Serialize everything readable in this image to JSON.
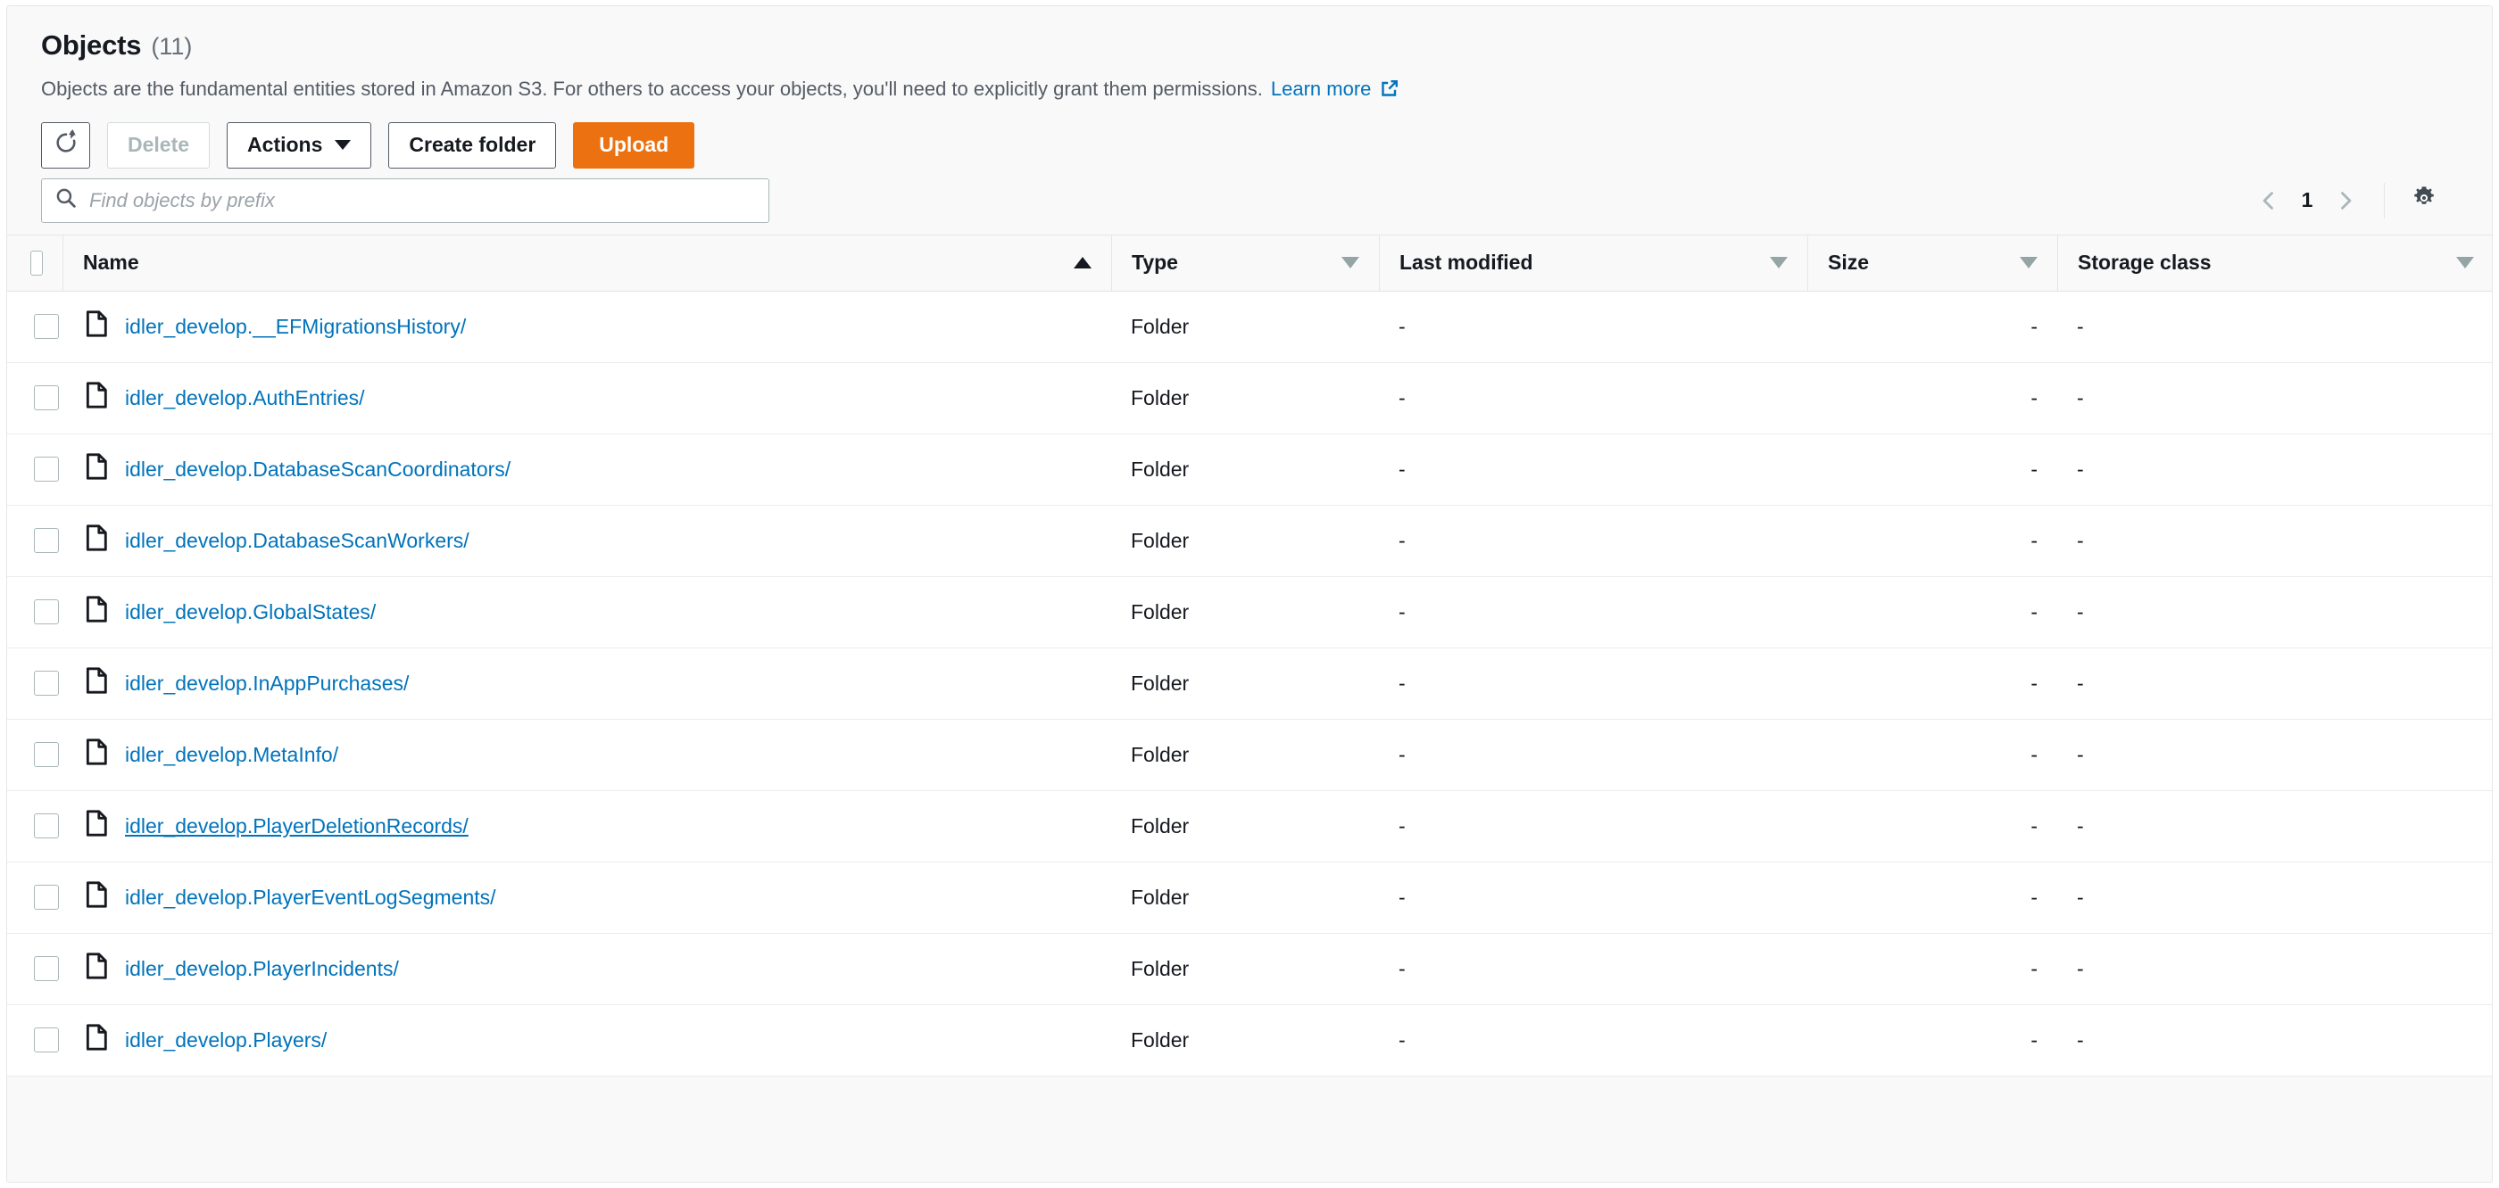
{
  "panel": {
    "title": "Objects",
    "count": "(11)",
    "description": "Objects are the fundamental entities stored in Amazon S3. For others to access your objects, you'll need to explicitly grant them permissions.",
    "learn_more_label": "Learn more",
    "learn_more_icon": "external-link-icon"
  },
  "toolbar": {
    "refresh_icon": "refresh-icon",
    "refresh_label": "",
    "delete_label": "Delete",
    "delete_disabled": true,
    "actions_label": "Actions",
    "actions_caret_icon": "chevron-down-icon",
    "create_folder_label": "Create folder",
    "upload_label": "Upload",
    "upload_color": "#ec7211"
  },
  "search": {
    "icon": "search-icon",
    "placeholder": "Find objects by prefix",
    "value": ""
  },
  "pagination": {
    "prev_icon": "chevron-left-icon",
    "page": "1",
    "next_icon": "chevron-right-icon",
    "settings_icon": "gear-icon"
  },
  "table": {
    "select_all_checkbox": "select-all-checkbox",
    "columns": [
      {
        "label": "Name",
        "sort": "asc",
        "sort_icon": "triangle-up-icon"
      },
      {
        "label": "Type",
        "sort": "none",
        "sort_icon": "triangle-down-outline-icon"
      },
      {
        "label": "Last modified",
        "sort": "none",
        "sort_icon": "triangle-down-outline-icon"
      },
      {
        "label": "Size",
        "sort": "none",
        "sort_icon": "triangle-down-outline-icon"
      },
      {
        "label": "Storage class",
        "sort": "none",
        "sort_icon": "triangle-down-outline-icon"
      }
    ],
    "rows": [
      {
        "name": "idler_develop.__EFMigrationsHistory/",
        "type": "Folder",
        "last_modified": "-",
        "size": "-",
        "storage_class": "-",
        "hovered": false,
        "icon": "folder-object-icon"
      },
      {
        "name": "idler_develop.AuthEntries/",
        "type": "Folder",
        "last_modified": "-",
        "size": "-",
        "storage_class": "-",
        "hovered": false,
        "icon": "folder-object-icon"
      },
      {
        "name": "idler_develop.DatabaseScanCoordinators/",
        "type": "Folder",
        "last_modified": "-",
        "size": "-",
        "storage_class": "-",
        "hovered": false,
        "icon": "folder-object-icon"
      },
      {
        "name": "idler_develop.DatabaseScanWorkers/",
        "type": "Folder",
        "last_modified": "-",
        "size": "-",
        "storage_class": "-",
        "hovered": false,
        "icon": "folder-object-icon"
      },
      {
        "name": "idler_develop.GlobalStates/",
        "type": "Folder",
        "last_modified": "-",
        "size": "-",
        "storage_class": "-",
        "hovered": false,
        "icon": "folder-object-icon"
      },
      {
        "name": "idler_develop.InAppPurchases/",
        "type": "Folder",
        "last_modified": "-",
        "size": "-",
        "storage_class": "-",
        "hovered": false,
        "icon": "folder-object-icon"
      },
      {
        "name": "idler_develop.MetaInfo/",
        "type": "Folder",
        "last_modified": "-",
        "size": "-",
        "storage_class": "-",
        "hovered": false,
        "icon": "folder-object-icon"
      },
      {
        "name": "idler_develop.PlayerDeletionRecords/",
        "type": "Folder",
        "last_modified": "-",
        "size": "-",
        "storage_class": "-",
        "hovered": true,
        "icon": "folder-object-icon"
      },
      {
        "name": "idler_develop.PlayerEventLogSegments/",
        "type": "Folder",
        "last_modified": "-",
        "size": "-",
        "storage_class": "-",
        "hovered": false,
        "icon": "folder-object-icon"
      },
      {
        "name": "idler_develop.PlayerIncidents/",
        "type": "Folder",
        "last_modified": "-",
        "size": "-",
        "storage_class": "-",
        "hovered": false,
        "icon": "folder-object-icon"
      },
      {
        "name": "idler_develop.Players/",
        "type": "Folder",
        "last_modified": "-",
        "size": "-",
        "storage_class": "-",
        "hovered": false,
        "icon": "folder-object-icon"
      }
    ]
  },
  "colors": {
    "link": "#0073bb",
    "accent": "#ec7211",
    "header_bg": "#f9f9fa",
    "row_bg": "#ffffff",
    "text": "#16191f",
    "muted": "#545b64"
  }
}
